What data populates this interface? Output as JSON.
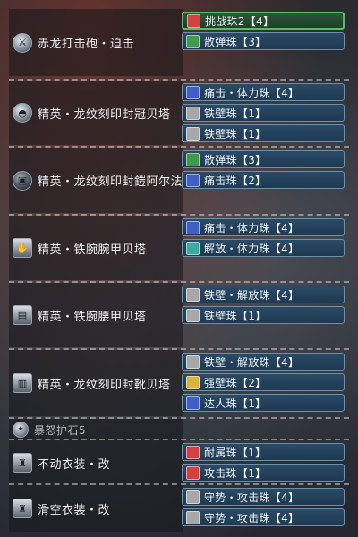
{
  "colors": {
    "red": "#d34242",
    "green": "#3f9a4c",
    "blue": "#4060c8",
    "gray": "#a8a8a8",
    "teal": "#3aa9a0",
    "gold": "#d9b43a",
    "purple": "#7a5ad0"
  },
  "groups": [
    {
      "icon": "weapon-icon",
      "name": "赤龙打击砲・迫击",
      "dim": false,
      "slots": [
        {
          "label": "挑战珠2【4】",
          "color": "red",
          "selected": true
        },
        {
          "label": "散弹珠【3】",
          "color": "green",
          "selected": false
        }
      ]
    },
    {
      "icon": "helm-icon",
      "name": "精英・龙纹刻印封冠贝塔",
      "dim": false,
      "slots": [
        {
          "label": "痛击・体力珠【4】",
          "color": "blue",
          "selected": false
        },
        {
          "label": "铁壁珠【1】",
          "color": "gray",
          "selected": false
        },
        {
          "label": "铁壁珠【1】",
          "color": "gray",
          "selected": false
        }
      ]
    },
    {
      "icon": "chest-armor-icon",
      "name": "精英・龙纹刻印封鎧阿尔法",
      "dim": false,
      "slots": [
        {
          "label": "散弹珠【3】",
          "color": "green",
          "selected": false
        },
        {
          "label": "痛击珠【2】",
          "color": "blue",
          "selected": false
        }
      ]
    },
    {
      "icon": "arm-armor-icon",
      "name": "精英・铁腕腕甲贝塔",
      "dim": false,
      "slots": [
        {
          "label": "痛击・体力珠【4】",
          "color": "blue",
          "selected": false
        },
        {
          "label": "解放・体力珠【4】",
          "color": "teal",
          "selected": false
        }
      ]
    },
    {
      "icon": "waist-armor-icon",
      "name": "精英・铁腕腰甲贝塔",
      "dim": false,
      "slots": [
        {
          "label": "铁壁・解放珠【4】",
          "color": "gray",
          "selected": false
        },
        {
          "label": "铁壁珠【1】",
          "color": "gray",
          "selected": false
        }
      ]
    },
    {
      "icon": "leg-armor-icon",
      "name": "精英・龙纹刻印封靴贝塔",
      "dim": false,
      "slots": [
        {
          "label": "铁壁・解放珠【4】",
          "color": "gray",
          "selected": false
        },
        {
          "label": "强壁珠【2】",
          "color": "gold",
          "selected": false
        },
        {
          "label": "达人珠【1】",
          "color": "blue",
          "selected": false
        }
      ]
    },
    {
      "icon": "charm-icon",
      "name": "暴怒护石5",
      "dim": true,
      "slots": []
    },
    {
      "icon": "mantle-icon",
      "name": "不动衣装・改",
      "dim": false,
      "slots": [
        {
          "label": "耐属珠【1】",
          "color": "red",
          "selected": false
        },
        {
          "label": "攻击珠【1】",
          "color": "red",
          "selected": false
        }
      ]
    },
    {
      "icon": "mantle-icon",
      "name": "滑空衣装・改",
      "dim": false,
      "slots": [
        {
          "label": "守势・攻击珠【4】",
          "color": "gray",
          "selected": false
        },
        {
          "label": "守势・攻击珠【4】",
          "color": "gray",
          "selected": false
        }
      ]
    }
  ]
}
